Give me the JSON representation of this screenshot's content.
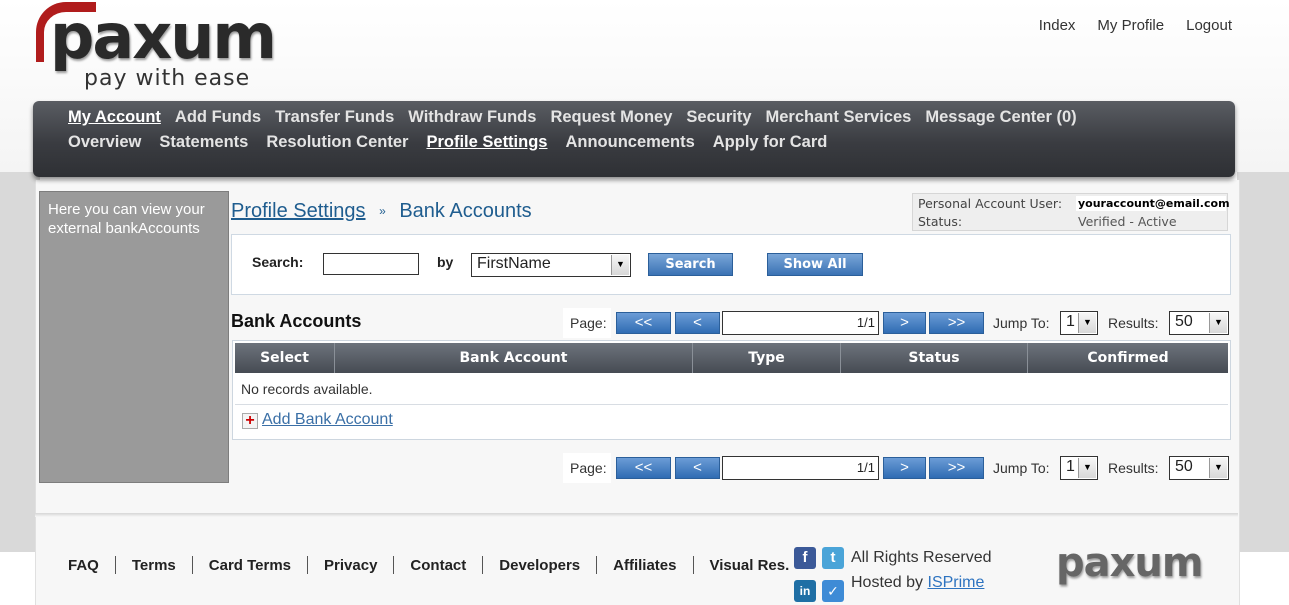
{
  "brand": {
    "logo_text": "paxum",
    "tagline": "pay with ease",
    "footer_logo_text": "paxum"
  },
  "top_links": [
    "Index",
    "My Profile",
    "Logout"
  ],
  "nav": {
    "row1": [
      "My Account",
      "Add Funds",
      "Transfer Funds",
      "Withdraw Funds",
      "Request Money",
      "Security",
      "Merchant Services",
      "Message Center (0)"
    ],
    "row2": [
      "Overview",
      "Statements",
      "Resolution Center",
      "Profile Settings",
      "Announcements",
      "Apply for Card"
    ]
  },
  "sidebar": {
    "text": "Here you can view your external bankAccounts"
  },
  "breadcrumb": {
    "parent": "Profile Settings",
    "separator": "»",
    "current": "Bank Accounts"
  },
  "account": {
    "user_label": "Personal Account User:",
    "email": "youraccount@email.com",
    "status_label": "Status:",
    "status_value": "Verified - Active"
  },
  "search": {
    "label": "Search:",
    "value": "",
    "by_label": "by",
    "by_selected": "FirstName",
    "search_button": "Search",
    "show_all_button": "Show All"
  },
  "section_title": "Bank Accounts",
  "pager": {
    "page_label": "Page:",
    "first": "<<",
    "prev": "<",
    "page_value": "1/1",
    "next": ">",
    "last": ">>",
    "jump_label": "Jump To:",
    "jump_value": "1",
    "results_label": "Results:",
    "results_value": "50"
  },
  "table": {
    "columns": [
      "Select",
      "Bank Account",
      "Type",
      "Status",
      "Confirmed"
    ],
    "empty_text": "No records available.",
    "add_link": "Add Bank Account"
  },
  "footer": {
    "links": [
      "FAQ",
      "Terms",
      "Card Terms",
      "Privacy",
      "Contact",
      "Developers",
      "Affiliates",
      "Visual Res."
    ],
    "rights": "All Rights Reserved",
    "hosted_by": "Hosted by",
    "host_name": "ISPrime",
    "social_icons": [
      "facebook-icon",
      "twitter-icon",
      "linkedin-icon",
      "checkmark-icon"
    ]
  },
  "colors": {
    "nav_bg": "#3a3c41",
    "accent_blue": "#3a72b4",
    "logo_red": "#b01c1c",
    "link_blue": "#1f5d8f"
  }
}
